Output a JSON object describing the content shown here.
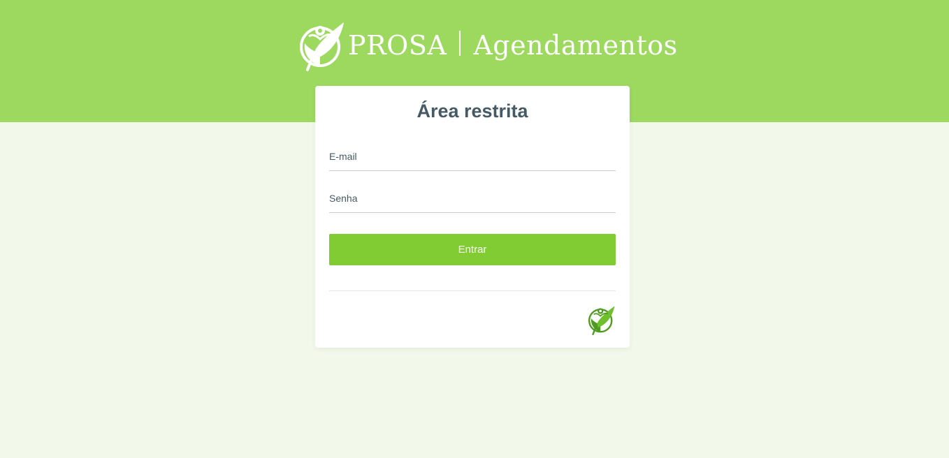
{
  "header": {
    "brand_name": "PROSA",
    "app_name": "Agendamentos",
    "background_color": "#9dd95f",
    "logo_icon": "prosa-leaf-logo-icon"
  },
  "login": {
    "title": "Área restrita",
    "email_placeholder": "E-mail",
    "password_placeholder": "Senha",
    "submit_label": "Entrar",
    "submit_color": "#80cc32",
    "footer_icon": "prosa-leaf-logo-icon"
  },
  "page": {
    "background_color": "#f2f8ea"
  }
}
